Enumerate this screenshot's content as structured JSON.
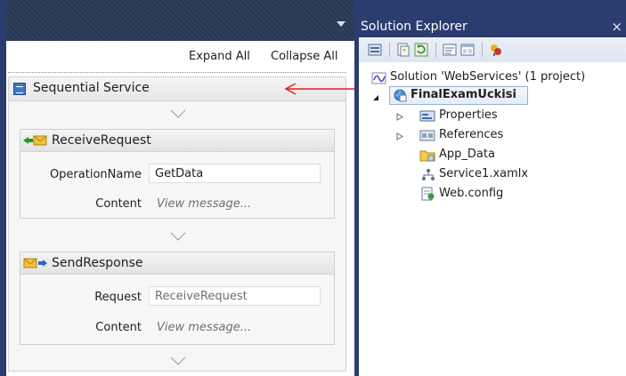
{
  "designer": {
    "expand_all": "Expand All",
    "collapse_all": "Collapse All",
    "sequence_title": "Sequential Service",
    "receive": {
      "title": "ReceiveRequest",
      "operation_label": "OperationName",
      "operation_value": "GetData",
      "content_label": "Content",
      "content_value": "View message..."
    },
    "send": {
      "title": "SendResponse",
      "request_label": "Request",
      "request_value": "ReceiveRequest",
      "content_label": "Content",
      "content_value": "View message..."
    }
  },
  "solution_explorer": {
    "title": "Solution Explorer",
    "close": "×",
    "tree": {
      "solution": "Solution 'WebServices' (1 project)",
      "project": "FinalExamUckisi",
      "items": [
        "Properties",
        "References",
        "App_Data",
        "Service1.xamlx",
        "Web.config"
      ]
    }
  },
  "colors": {
    "titlebar": "#2b3c6e",
    "annotation_arrow": "#e02020"
  },
  "icons": [
    "sequence-icon",
    "receive-icon",
    "send-icon",
    "solution-icon",
    "project-icon",
    "properties-icon",
    "references-icon",
    "folder-icon",
    "xamlx-icon",
    "config-icon"
  ]
}
